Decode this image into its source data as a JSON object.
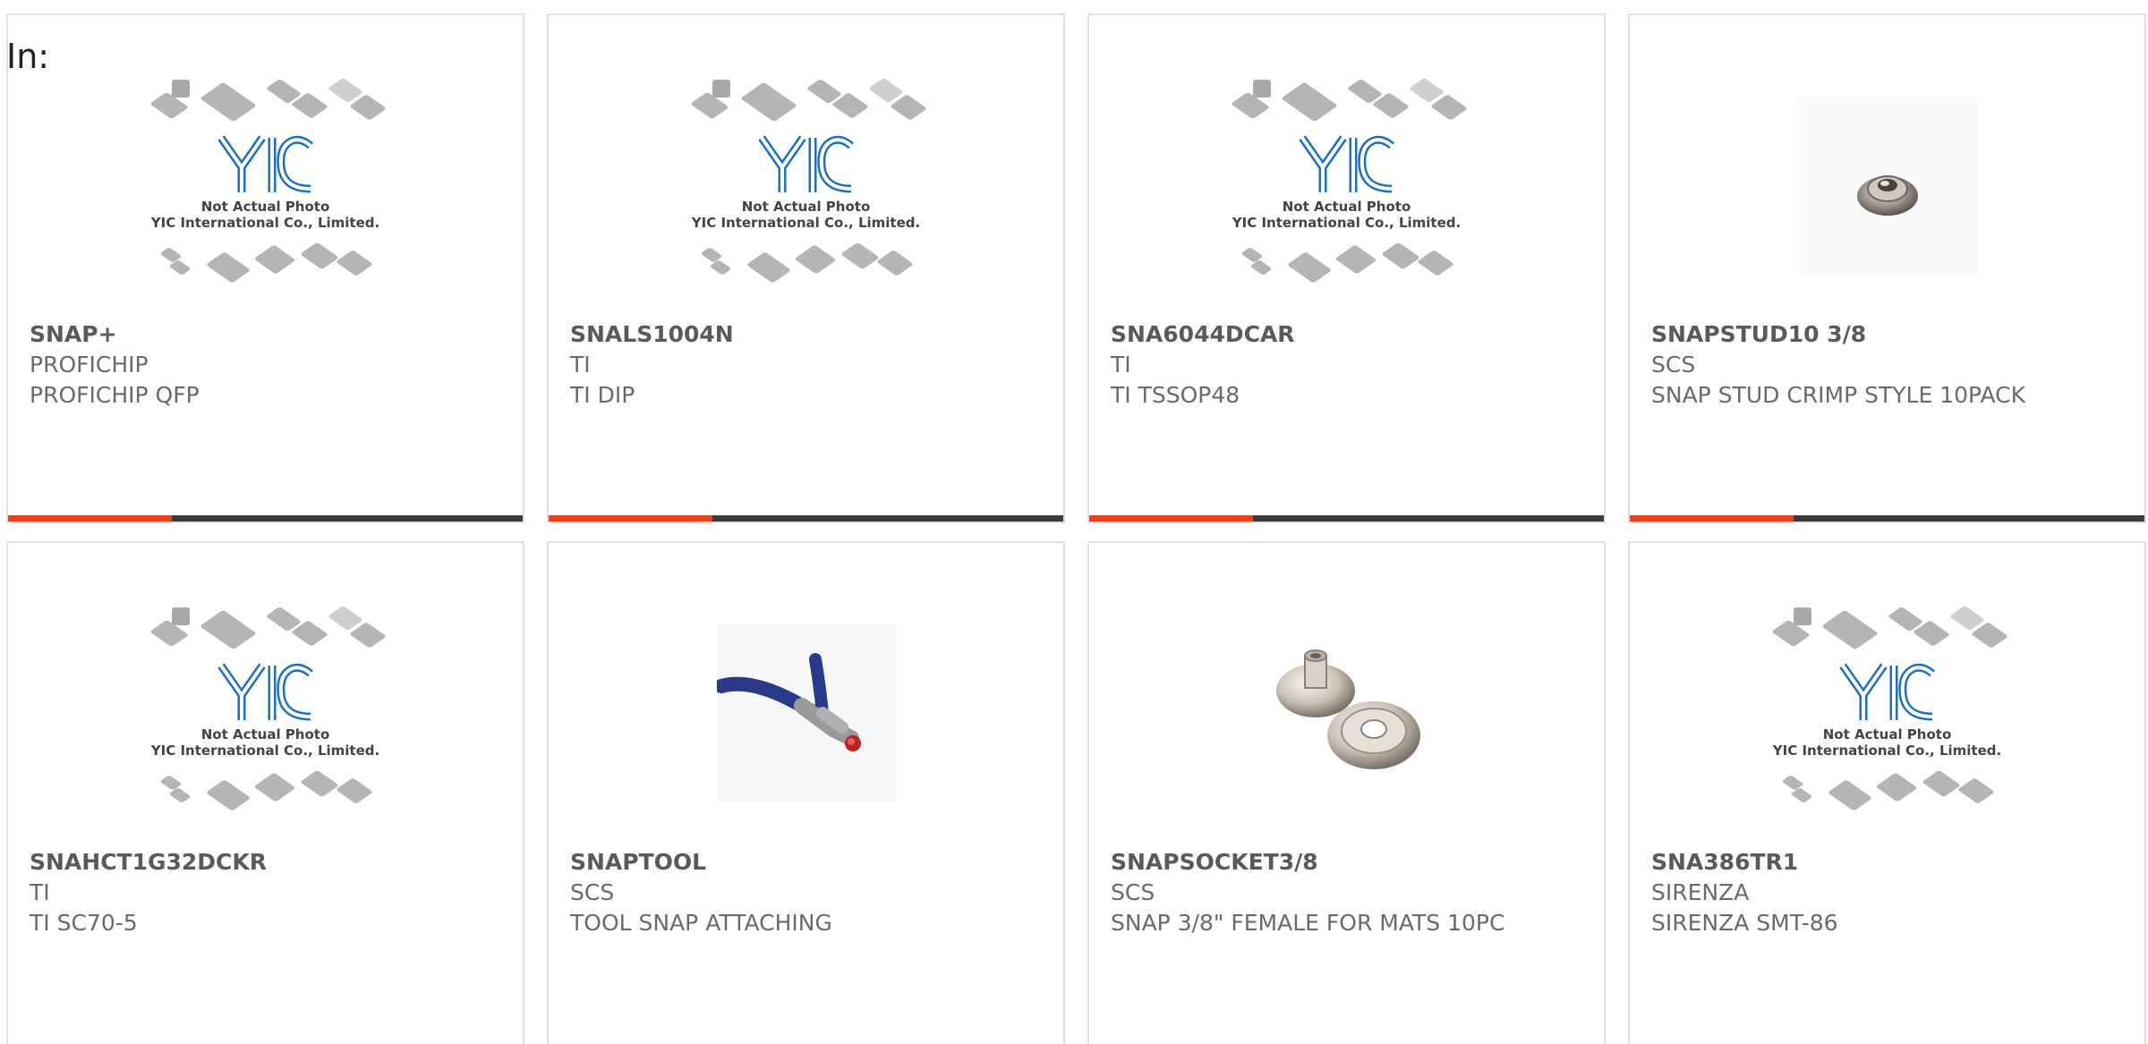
{
  "header": {
    "in_label": "In:"
  },
  "placeholder": {
    "line1": "Not Actual Photo",
    "line2": "YIC International Co., Limited."
  },
  "colors": {
    "accent": "#e8431c",
    "bar": "#3c3c3c",
    "border": "#e0e0e0"
  },
  "products": [
    {
      "part_number": "SNAP+",
      "manufacturer": "PROFICHIP",
      "description": "PROFICHIP QFP",
      "image": "placeholder"
    },
    {
      "part_number": "SNALS1004N",
      "manufacturer": "TI",
      "description": "TI DIP",
      "image": "placeholder"
    },
    {
      "part_number": "SNA6044DCAR",
      "manufacturer": "TI",
      "description": "TI TSSOP48",
      "image": "placeholder"
    },
    {
      "part_number": "SNAPSTUD10 3/8",
      "manufacturer": "SCS",
      "description": "SNAP STUD CRIMP STYLE 10PACK",
      "image": "snap-stud"
    },
    {
      "part_number": "SNAHCT1G32DCKR",
      "manufacturer": "TI",
      "description": "TI SC70-5",
      "image": "placeholder"
    },
    {
      "part_number": "SNAPTOOL",
      "manufacturer": "SCS",
      "description": "TOOL SNAP ATTACHING",
      "image": "pliers"
    },
    {
      "part_number": "SNAPSOCKET3/8",
      "manufacturer": "SCS",
      "description": "SNAP 3/8\" FEMALE FOR MATS 10PC",
      "image": "snap-socket"
    },
    {
      "part_number": "SNA386TR1",
      "manufacturer": "SIRENZA",
      "description": "SIRENZA SMT-86",
      "image": "placeholder"
    }
  ]
}
